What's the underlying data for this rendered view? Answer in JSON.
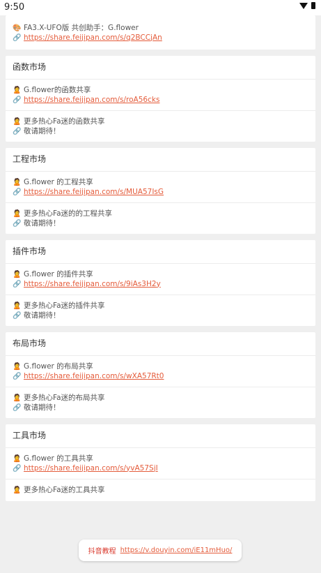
{
  "status_bar": {
    "time": "9:50"
  },
  "top_card": {
    "line1": "FA3.X-UFO版 共创助手：G.flower",
    "link": "https://share.feijipan.com/s/q2BCCjAn"
  },
  "sections": [
    {
      "title": "函数市场",
      "items": [
        {
          "text": "G.flower的函数共享",
          "sub": "https://share.feijipan.com/s/roA56cks",
          "sub_is_link": true
        },
        {
          "text": "更多热心Fa迷的函数共享",
          "sub": "敬请期待！",
          "sub_is_link": false
        }
      ]
    },
    {
      "title": "工程市场",
      "items": [
        {
          "text": "G.flower 的工程共享",
          "sub": "https://share.feijipan.com/s/MUA57IsG",
          "sub_is_link": true
        },
        {
          "text": "更多热心Fa迷的的工程共享",
          "sub": "敬请期待！",
          "sub_is_link": false
        }
      ]
    },
    {
      "title": "插件市场",
      "items": [
        {
          "text": "G.flower 的插件共享",
          "sub": "https://share.feijipan.com/s/9iAs3H2y",
          "sub_is_link": true
        },
        {
          "text": "更多热心Fa迷的插件共享",
          "sub": "敬请期待！",
          "sub_is_link": false
        }
      ]
    },
    {
      "title": "布局市场",
      "items": [
        {
          "text": "G.flower 的布局共享",
          "sub": "https://share.feijipan.com/s/wXA57Rt0",
          "sub_is_link": true
        },
        {
          "text": "更多热心Fa迷的布局共享",
          "sub": "敬请期待！",
          "sub_is_link": false
        }
      ]
    },
    {
      "title": "工具市场",
      "items": [
        {
          "text": "G.flower 的工具共享",
          "sub": "https://share.feijipan.com/s/yvA57SjI",
          "sub_is_link": true
        },
        {
          "text": "更多热心Fa迷的工具共享",
          "sub": "",
          "sub_is_link": false
        }
      ]
    }
  ],
  "footer": {
    "label": "抖音教程",
    "url": "https://v.douyin.com/iE11mHuo/"
  },
  "icons": {
    "person": "person-icon",
    "link": "link-icon",
    "palette": "palette-icon"
  }
}
